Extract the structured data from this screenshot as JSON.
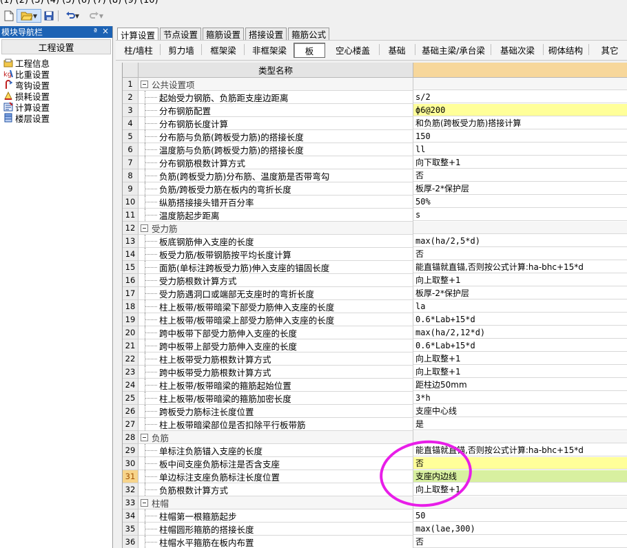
{
  "menu": {
    "clipped_text": "(1)  (2) (3)  (4) (5)    (6) (7)   (8) (9)  (10)"
  },
  "toolbar": {
    "new_icon": "new-document-icon",
    "open_icon": "open-folder-icon",
    "save_icon": "save-disk-icon",
    "undo_icon": "undo-icon",
    "redo_icon": "redo-icon"
  },
  "nav": {
    "title": "模块导航栏",
    "pin": "ª",
    "close": "×",
    "header": "工程设置",
    "items": [
      {
        "label": "工程信息",
        "icon": "project-info-icon"
      },
      {
        "label": "比重设置",
        "icon": "weight-setting-icon"
      },
      {
        "label": "弯钩设置",
        "icon": "hook-setting-icon"
      },
      {
        "label": "损耗设置",
        "icon": "loss-setting-icon"
      },
      {
        "label": "计算设置",
        "icon": "calc-setting-icon"
      },
      {
        "label": "楼层设置",
        "icon": "floor-setting-icon"
      }
    ]
  },
  "tabs": [
    {
      "label": "计算设置",
      "active": true
    },
    {
      "label": "节点设置",
      "active": false
    },
    {
      "label": "箍筋设置",
      "active": false
    },
    {
      "label": "搭接设置",
      "active": false
    },
    {
      "label": "箍筋公式",
      "active": false
    }
  ],
  "subtabs": [
    {
      "label": "柱/墙柱"
    },
    {
      "label": "剪力墙"
    },
    {
      "label": "框架梁"
    },
    {
      "label": "非框架梁"
    },
    {
      "label": "板",
      "active": true
    },
    {
      "label": "空心楼盖"
    },
    {
      "label": "基础"
    },
    {
      "label": "基础主梁/承台梁"
    },
    {
      "label": "基础次梁"
    },
    {
      "label": "砌体结构"
    },
    {
      "label": "其它"
    }
  ],
  "grid": {
    "header": "类型名称",
    "selected_row": "31",
    "rows": [
      {
        "n": "1",
        "name": "公共设置项",
        "value": "",
        "group": true
      },
      {
        "n": "2",
        "name": "起始受力钢筋、负筋距支座边距离",
        "value": "s/2"
      },
      {
        "n": "3",
        "name": "分布钢筋配置",
        "value": "ф6@200",
        "bg": "yellow"
      },
      {
        "n": "4",
        "name": "分布钢筋长度计算",
        "value": "和负筋(跨板受力筋)搭接计算",
        "cn": true
      },
      {
        "n": "5",
        "name": "分布筋与负筋(跨板受力筋)的搭接长度",
        "value": "150"
      },
      {
        "n": "6",
        "name": "温度筋与负筋(跨板受力筋)的搭接长度",
        "value": "ll"
      },
      {
        "n": "7",
        "name": "分布钢筋根数计算方式",
        "value": "向下取整+1",
        "cn": true
      },
      {
        "n": "8",
        "name": "负筋(跨板受力筋)分布筋、温度筋是否带弯勾",
        "value": "否",
        "cn": true
      },
      {
        "n": "9",
        "name": "负筋/跨板受力筋在板内的弯折长度",
        "value": "板厚-2*保护层",
        "cn": true
      },
      {
        "n": "10",
        "name": "纵筋搭接接头错开百分率",
        "value": "50%"
      },
      {
        "n": "11",
        "name": "温度筋起步距离",
        "value": "s"
      },
      {
        "n": "12",
        "name": "受力筋",
        "value": "",
        "group": true
      },
      {
        "n": "13",
        "name": "板底钢筋伸入支座的长度",
        "value": "max(ha/2,5*d)"
      },
      {
        "n": "14",
        "name": "板受力筋/板带钢筋按平均长度计算",
        "value": "否",
        "cn": true
      },
      {
        "n": "15",
        "name": "面筋(单标注跨板受力筋)伸入支座的锚固长度",
        "value": "能直锚就直锚,否则按公式计算:ha-bhc+15*d",
        "cn": true
      },
      {
        "n": "16",
        "name": "受力筋根数计算方式",
        "value": "向上取整+1",
        "cn": true
      },
      {
        "n": "17",
        "name": "受力筋遇洞口或端部无支座时的弯折长度",
        "value": "板厚-2*保护层",
        "cn": true
      },
      {
        "n": "18",
        "name": "柱上板带/板带暗梁下部受力筋伸入支座的长度",
        "value": "la"
      },
      {
        "n": "19",
        "name": "柱上板带/板带暗梁上部受力筋伸入支座的长度",
        "value": "0.6*Lab+15*d"
      },
      {
        "n": "20",
        "name": "跨中板带下部受力筋伸入支座的长度",
        "value": "max(ha/2,12*d)"
      },
      {
        "n": "21",
        "name": "跨中板带上部受力筋伸入支座的长度",
        "value": "0.6*Lab+15*d"
      },
      {
        "n": "22",
        "name": "柱上板带受力筋根数计算方式",
        "value": "向上取整+1",
        "cn": true
      },
      {
        "n": "23",
        "name": "跨中板带受力筋根数计算方式",
        "value": "向上取整+1",
        "cn": true
      },
      {
        "n": "24",
        "name": "柱上板带/板带暗梁的箍筋起始位置",
        "value": "距柱边50mm",
        "cn": true
      },
      {
        "n": "25",
        "name": "柱上板带/板带暗梁的箍筋加密长度",
        "value": "3*h"
      },
      {
        "n": "26",
        "name": "跨板受力筋标注长度位置",
        "value": "支座中心线",
        "cn": true
      },
      {
        "n": "27",
        "name": "柱上板带暗梁部位是否扣除平行板带筋",
        "value": "是",
        "cn": true
      },
      {
        "n": "28",
        "name": "负筋",
        "value": "",
        "group": true
      },
      {
        "n": "29",
        "name": "单标注负筋锚入支座的长度",
        "value": "能直锚就直锚,否则按公式计算:ha-bhc+15*d",
        "cn": true
      },
      {
        "n": "30",
        "name": "板中间支座负筋标注是否含支座",
        "value": "否",
        "cn": true,
        "bg": "yellow"
      },
      {
        "n": "31",
        "name": "单边标注支座负筋标注长度位置",
        "value": "支座内边线",
        "cn": true,
        "bg": "green"
      },
      {
        "n": "32",
        "name": "负筋根数计算方式",
        "value": "向上取整+1",
        "cn": true
      },
      {
        "n": "33",
        "name": "柱帽",
        "value": "",
        "group": true
      },
      {
        "n": "34",
        "name": "柱帽第一根箍筋起步",
        "value": "50"
      },
      {
        "n": "35",
        "name": "柱帽圆形箍筋的搭接长度",
        "value": "max(lae,300)"
      },
      {
        "n": "36",
        "name": "柱帽水平箍筋在板内布置",
        "value": "否",
        "cn": true
      }
    ]
  },
  "colors": {
    "nav_title_bg": "#1c62b4",
    "header_value_bg": "#f7d79b",
    "highlight_circle": "#e81ee8",
    "row_yellow": "#ffff99",
    "row_green": "#d8f0a0"
  }
}
